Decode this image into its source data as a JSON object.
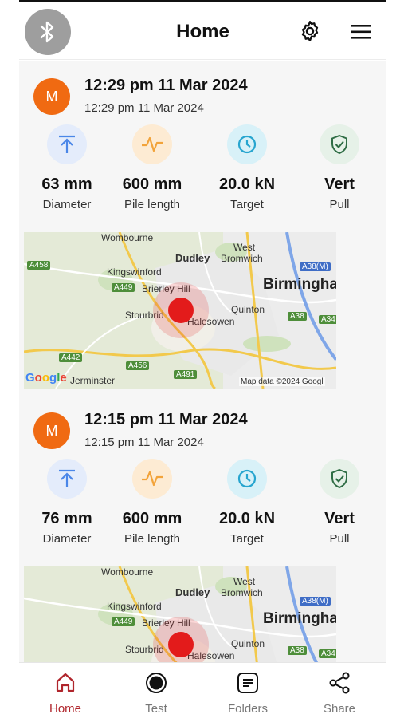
{
  "header": {
    "title": "Home"
  },
  "colors": {
    "accent": "#b0252c",
    "avatar": "#f06a12",
    "marker": "#e31b1b",
    "diameter_icon_bg": "#e4ecfb",
    "pile_icon_bg": "#fdebd3",
    "target_icon_bg": "#d8f1f8",
    "pull_icon_bg": "#e6f1e8"
  },
  "cards": [
    {
      "avatar_letter": "M",
      "title": "12:29 pm 11 Mar 2024",
      "subtitle": "12:29 pm 11 Mar 2024",
      "stats": [
        {
          "icon": "arrow-up-bar-icon",
          "value": "63 mm",
          "label": "Diameter"
        },
        {
          "icon": "pulse-icon",
          "value": "600 mm",
          "label": "Pile length"
        },
        {
          "icon": "clock-icon",
          "value": "20.0 kN",
          "label": "Target"
        },
        {
          "icon": "shield-check-icon",
          "value": "Vert",
          "label": "Pull"
        }
      ],
      "map": {
        "places": [
          "Wombourne",
          "West",
          "Bromwich",
          "Dudley",
          "Kingswinford",
          "Birmingha",
          "Brierley Hill",
          "Quinton",
          "Stourbrid",
          "Halesowen",
          "Jerminster"
        ],
        "roads": [
          "A458",
          "A449",
          "A38(M)",
          "A38",
          "A34",
          "A442",
          "A456",
          "A491"
        ],
        "google_logo": "Google",
        "attribution": "Map data ©2024 Googl"
      }
    },
    {
      "avatar_letter": "M",
      "title": "12:15 pm 11 Mar 2024",
      "subtitle": "12:15 pm 11 Mar 2024",
      "stats": [
        {
          "icon": "arrow-up-bar-icon",
          "value": "76 mm",
          "label": "Diameter"
        },
        {
          "icon": "pulse-icon",
          "value": "600 mm",
          "label": "Pile length"
        },
        {
          "icon": "clock-icon",
          "value": "20.0 kN",
          "label": "Target"
        },
        {
          "icon": "shield-check-icon",
          "value": "Vert",
          "label": "Pull"
        }
      ],
      "map": {
        "places": [
          "Wombourne",
          "West",
          "Bromwich",
          "Dudley",
          "Kingswinford",
          "Birmingha",
          "Brierley Hill",
          "Quinton",
          "Stourbrid",
          "Halesowen"
        ],
        "roads": [
          "A449",
          "A38(M)",
          "A38",
          "A34"
        ]
      }
    }
  ],
  "nav": [
    {
      "label": "Home",
      "icon": "home-icon",
      "active": true
    },
    {
      "label": "Test",
      "icon": "record-icon",
      "active": false
    },
    {
      "label": "Folders",
      "icon": "folder-list-icon",
      "active": false
    },
    {
      "label": "Share",
      "icon": "share-icon",
      "active": false
    }
  ]
}
